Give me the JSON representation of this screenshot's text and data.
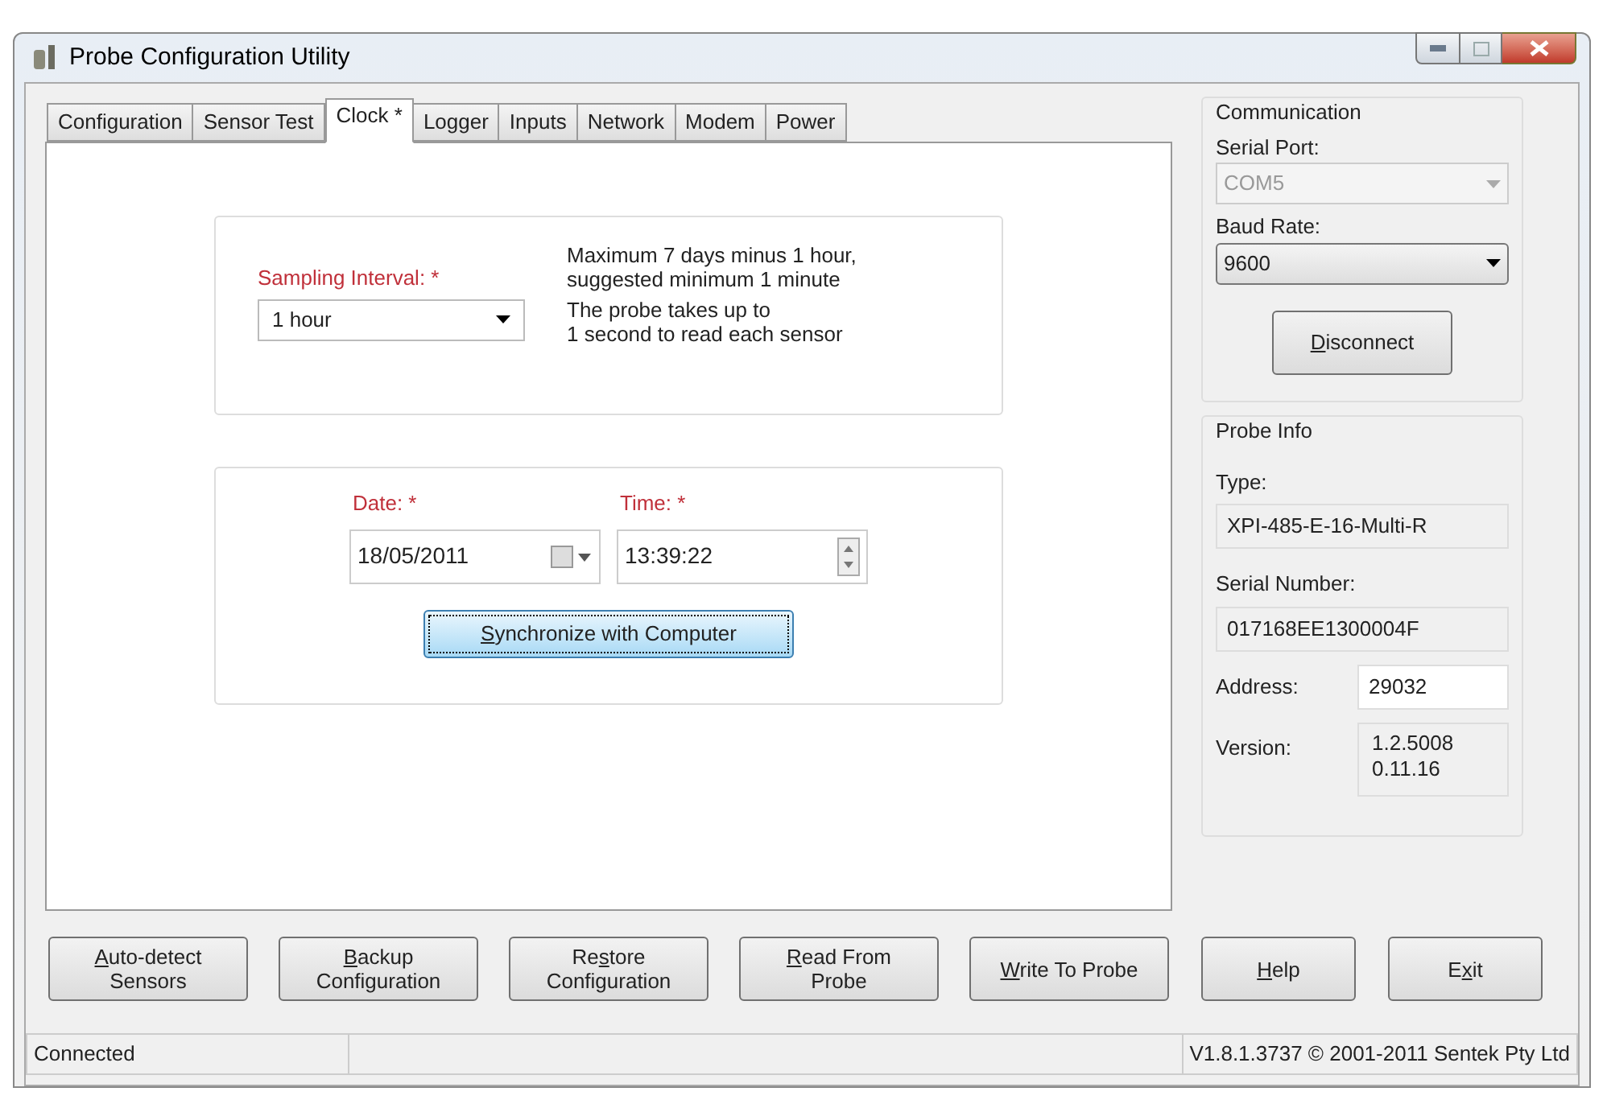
{
  "window": {
    "title": "Probe Configuration Utility"
  },
  "tabs": [
    {
      "label": "Configuration",
      "selected": false
    },
    {
      "label": "Sensor Test",
      "selected": false
    },
    {
      "label": "Clock *",
      "selected": true
    },
    {
      "label": "Logger",
      "selected": false
    },
    {
      "label": "Inputs",
      "selected": false
    },
    {
      "label": "Network",
      "selected": false
    },
    {
      "label": "Modem",
      "selected": false
    },
    {
      "label": "Power",
      "selected": false
    }
  ],
  "sampling": {
    "label": "Sampling Interval: *",
    "required": true,
    "value": "1 hour",
    "notes": [
      "Maximum 7 days minus 1 hour,\nsuggested minimum 1 minute",
      "The probe takes up to\n1 second to read each sensor"
    ]
  },
  "clock": {
    "date": {
      "label": "Date: *",
      "required": true,
      "value": "18/05/2011"
    },
    "time": {
      "label": "Time: *",
      "required": true,
      "value": "13:39:22"
    },
    "sync_button": {
      "key": "S",
      "post": "ynchronize with Computer",
      "focused": true
    }
  },
  "communication": {
    "title": "Communication",
    "serial_port": {
      "label": "Serial Port:",
      "value": "COM5",
      "disabled": true
    },
    "baud_rate": {
      "label": "Baud Rate:",
      "value": "9600",
      "disabled": false
    },
    "disconnect_button": {
      "key": "D",
      "post": "isconnect"
    }
  },
  "probe_info": {
    "title": "Probe Info",
    "type_label": "Type:",
    "type_value": "XPI-485-E-16-Multi-R",
    "serial_label": "Serial Number:",
    "serial_value": "017168EE1300004F",
    "address_label": "Address:",
    "address_value": "29032",
    "version_label": "Version:",
    "version_value": "1.2.5008\n0.11.16"
  },
  "buttons": [
    {
      "key": "A",
      "post": "uto-detect\nSensors"
    },
    {
      "key": "B",
      "post": "ackup\nConfiguration"
    },
    {
      "pre": "Re",
      "key": "s",
      "post": "tore\nConfiguration"
    },
    {
      "key": "R",
      "post": "ead From\nProbe"
    },
    {
      "key": "W",
      "post": "rite To Probe"
    }
  ],
  "side_buttons": [
    {
      "key": "H",
      "post": "elp"
    },
    {
      "pre": "E",
      "key": "x",
      "post": "it"
    }
  ],
  "status_bar": {
    "status": "Connected",
    "copyright": "V1.8.1.3737 © 2001-2011 Sentek Pty Ltd"
  }
}
